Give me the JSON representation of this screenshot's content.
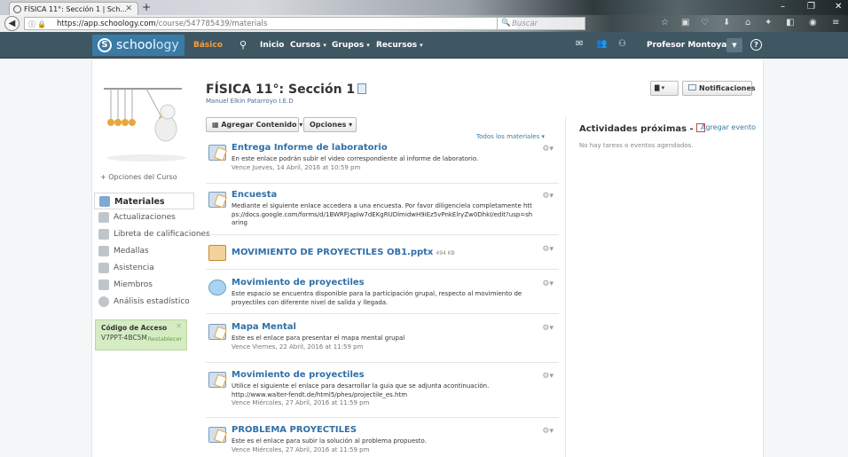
{
  "browser": {
    "tab_title": "FÍSICA 11°: Sección 1 | Sch...",
    "tab_close": "✕",
    "new_tab": "+",
    "url_host": "https://app.schoology.com",
    "url_path": "/course/547785439/materials",
    "search_placeholder": "Buscar",
    "window_min": "–",
    "window_max": "❐",
    "window_close": "✕"
  },
  "header": {
    "logo_text_a": "school",
    "logo_text_b": "ogy",
    "plan": "Básico",
    "nav": [
      {
        "label": "Inicio"
      },
      {
        "label": "Cursos"
      },
      {
        "label": "Grupos"
      },
      {
        "label": "Recursos"
      }
    ],
    "user": "Profesor Montoya",
    "help": "?"
  },
  "sidebar": {
    "course_options": "+ Opciones del Curso",
    "items": [
      {
        "label": "Materiales",
        "icon": "materials-icon",
        "active": true
      },
      {
        "label": "Actualizaciones",
        "icon": "updates-icon"
      },
      {
        "label": "Libreta de calificaciones",
        "icon": "gradebook-icon"
      },
      {
        "label": "Medallas",
        "icon": "badges-icon"
      },
      {
        "label": "Asistencia",
        "icon": "attendance-icon"
      },
      {
        "label": "Miembros",
        "icon": "members-icon"
      },
      {
        "label": "Análisis estadístico",
        "icon": "analytics-icon"
      }
    ],
    "access": {
      "title": "Código de Acceso",
      "code": "V7PPT-4BC5M",
      "reset": "Restablecer",
      "close": "✕"
    }
  },
  "course": {
    "title": "FÍSICA 11°: Sección 1",
    "teacher": "Manuel Elkin Patarroyo I.E.D",
    "view_button": "▾",
    "notifications": "Notificaciones",
    "add_content": "Agregar Contenido ▾",
    "options": "Opciones ▾",
    "filter": "Todos los materiales"
  },
  "materials": [
    {
      "title": "Entrega Informe de laboratorio",
      "desc": "En este enlace podrán subir el video correspondiente al informe de laboratorio.",
      "due": "Vence Jueves, 14 Abril, 2016 at 10:59 pm",
      "icon": "assignment-icon"
    },
    {
      "title": "Encuesta",
      "desc": "Mediante el siguiente enlace accedera a una encuesta. Por favor diligenciela completamente https://docs.google.com/forms/d/1BWRFJapIw7dEKgRUDlmidwH9iEz5vPnkElryZw0DhkI/edit?usp=sharing",
      "due": "",
      "icon": "assignment-icon"
    },
    {
      "title": "MOVIMIENTO DE PROYECTILES OB1.pptx",
      "size": "494 KB",
      "desc": "",
      "due": "",
      "icon": "ppt-file-icon"
    },
    {
      "title": "Movimiento de proyectiles",
      "desc": "Este espacio se encuentra disponible para la participación grupal, respecto al movimiento de proyectiles con diferente nivel de salida y llegada.",
      "due": "",
      "icon": "discussion-icon"
    },
    {
      "title": "Mapa Mental",
      "desc": "Este es el enlace para presentar el mapa mental grupal",
      "due": "Vence Viernes, 22 Abril, 2016 at 11:59 pm",
      "icon": "assignment-icon"
    },
    {
      "title": "Movimiento de proyectiles",
      "desc": "Utilice el siguiente el enlace para desarrollar la guia que se adjunta acontinuación. http://www.walter-fendt.de/html5/phes/projectile_es.htm",
      "due": "Vence Miércoles, 27 Abril, 2016 at 11:59 pm",
      "icon": "assignment-icon"
    },
    {
      "title": "PROBLEMA PROYECTILES",
      "desc": "Este es el enlace para subir la solución al problema propuesto.",
      "due": "Vence Miércoles, 27 Abril, 2016 at 11:59 pm",
      "icon": "assignment-icon"
    }
  ],
  "upcoming": {
    "title": "Actividades próximas",
    "add_event": "Agregar evento",
    "empty": "No hay tareas o eventos agendados."
  },
  "colors": {
    "header_bg": "#3f5763",
    "link": "#2f6fa8",
    "plan": "#ff9b3a"
  }
}
